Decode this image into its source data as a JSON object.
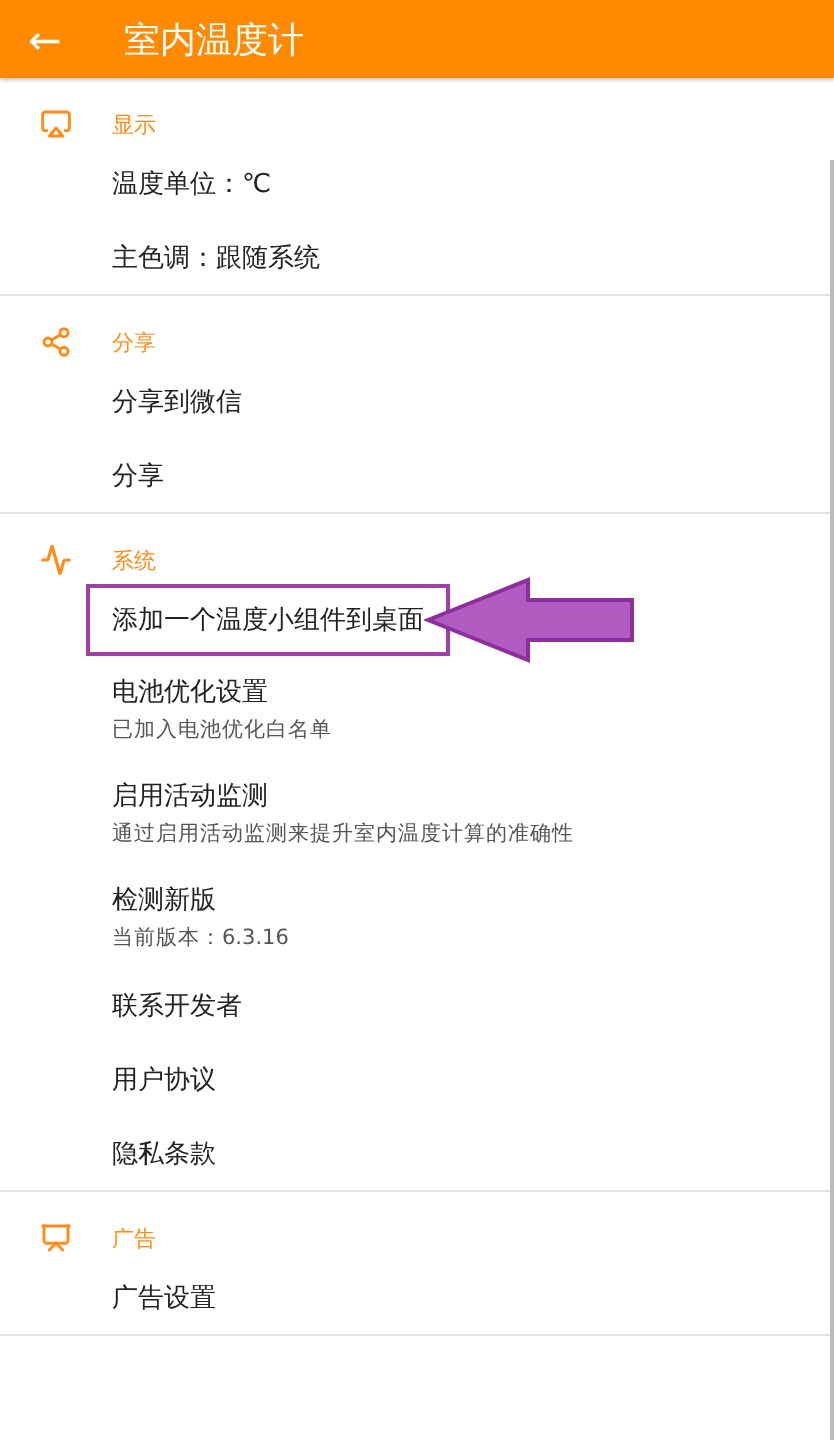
{
  "app_bar": {
    "back_icon": "←",
    "title": "室内温度计"
  },
  "sections": [
    {
      "title": "显示",
      "items": [
        {
          "title": "温度单位：℃",
          "highlighted": false
        },
        {
          "title": "主色调：跟随系统",
          "highlighted": false
        }
      ]
    },
    {
      "title": "分享",
      "items": [
        {
          "title": "分享到微信",
          "highlighted": false
        },
        {
          "title": "分享",
          "highlighted": false
        }
      ]
    },
    {
      "title": "系统",
      "items": [
        {
          "title": "添加一个温度小组件到桌面",
          "highlighted": true
        },
        {
          "title": "电池优化设置",
          "subtitle": "已加入电池优化白名单",
          "highlighted": false
        },
        {
          "title": "启用活动监测",
          "subtitle": "通过启用活动监测来提升室内温度计算的准确性",
          "highlighted": false
        },
        {
          "title": "检测新版",
          "subtitle": "当前版本：6.3.16",
          "highlighted": false
        },
        {
          "title": "联系开发者",
          "highlighted": false
        },
        {
          "title": "用户协议",
          "highlighted": false
        },
        {
          "title": "隐私条款",
          "highlighted": false
        }
      ]
    },
    {
      "title": "广告",
      "items": [
        {
          "title": "广告设置",
          "highlighted": false
        }
      ]
    }
  ]
}
